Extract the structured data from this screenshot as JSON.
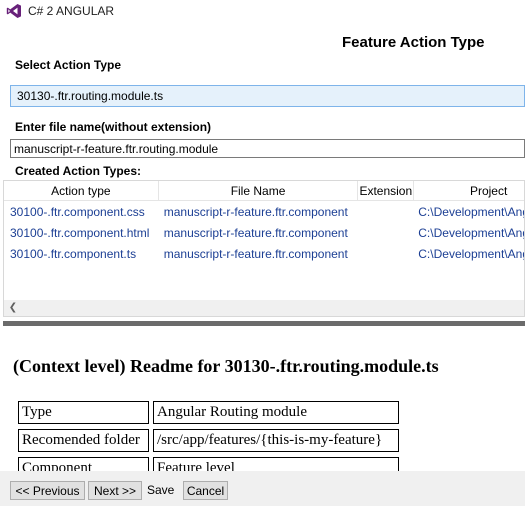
{
  "window": {
    "title": "C# 2 ANGULAR",
    "logo_icon": "visual-studio-icon",
    "logo_color": "#68217a"
  },
  "page": {
    "heading": "Feature Action Type"
  },
  "action_type": {
    "label": "Select Action Type",
    "selected": "30130-.ftr.routing.module.ts"
  },
  "file_name": {
    "label": "Enter file name(without extension)",
    "value": "manuscript-r-feature.ftr.routing.module"
  },
  "created": {
    "label": "Created Action Types:",
    "columns": [
      "Action type",
      "File Name",
      "Extension",
      "Project"
    ],
    "rows": [
      [
        "30100-.ftr.component.css",
        "manuscript-r-feature.ftr.component",
        "",
        "C:\\Development\\Ang"
      ],
      [
        "30100-.ftr.component.html",
        "manuscript-r-feature.ftr.component",
        "",
        "C:\\Development\\Ang"
      ],
      [
        "30100-.ftr.component.ts",
        "manuscript-r-feature.ftr.component",
        "",
        "C:\\Development\\Ang"
      ]
    ],
    "scroll_left_icon": "chevron-left-icon"
  },
  "readme": {
    "title": "(Context level) Readme for 30130-.ftr.routing.module.ts",
    "rows": [
      [
        "Type",
        "Angular Routing module"
      ],
      [
        "Recomended folder",
        "/src/app/features/{this-is-my-feature}"
      ],
      [
        "Component",
        "Feature level"
      ]
    ]
  },
  "buttons": {
    "previous": "<< Previous",
    "next": "Next >>",
    "save": "Save",
    "cancel": "Cancel"
  },
  "colors": {
    "link_text": "#1c3f94",
    "select_bg": "#e5f1fb",
    "select_border": "#7eb4ea"
  }
}
